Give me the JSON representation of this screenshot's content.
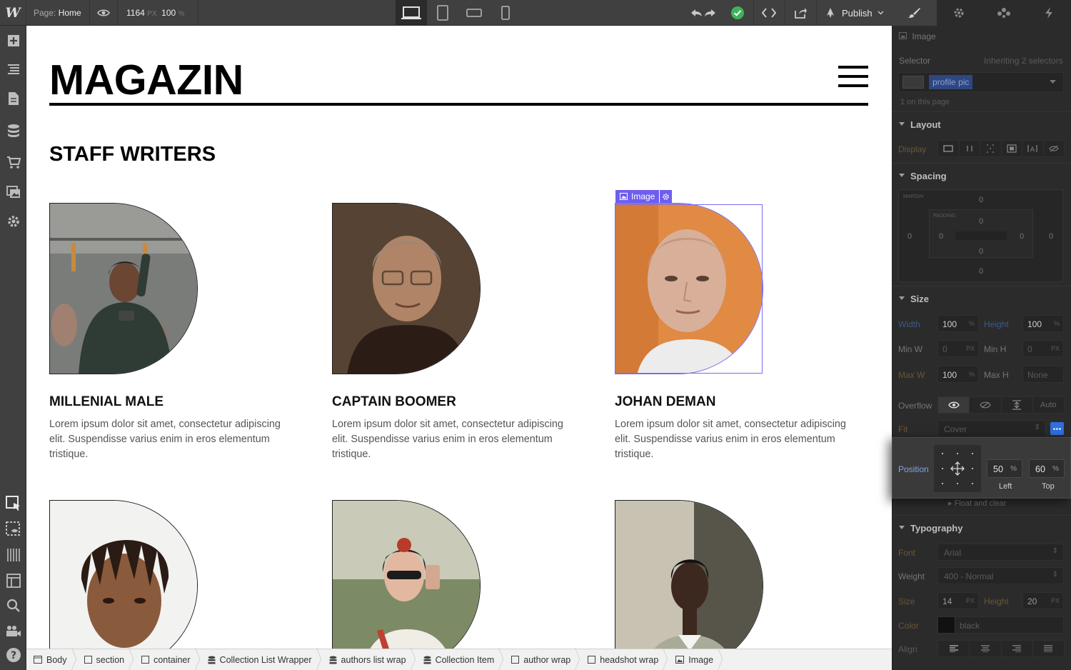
{
  "app": {
    "logo": "W",
    "page_label": "Page:",
    "page_name": "Home",
    "canvas_width": "1164",
    "canvas_width_unit": "PX",
    "zoom": "100",
    "zoom_unit": "%",
    "publish_label": "Publish"
  },
  "site": {
    "brand": "MAGAZIN",
    "section_title": "STAFF WRITERS",
    "selected_label": "Image",
    "writers": [
      {
        "name": "MILLENIAL MALE",
        "bio": "Lorem ipsum dolor sit amet, consectetur adipiscing elit. Suspendisse varius enim in eros elementum tristique."
      },
      {
        "name": "CAPTAIN BOOMER",
        "bio": "Lorem ipsum dolor sit amet, consectetur adipiscing elit. Suspendisse varius enim in eros elementum tristique."
      },
      {
        "name": "JOHAN DEMAN",
        "bio": "Lorem ipsum dolor sit amet, consectetur adipiscing elit. Suspendisse varius enim in eros elementum tristique."
      }
    ]
  },
  "breadcrumbs": [
    "Body",
    "section",
    "container",
    "Collection List Wrapper",
    "authors list wrap",
    "Collection Item",
    "author wrap",
    "headshot wrap",
    "Image"
  ],
  "panel": {
    "element_type": "Image",
    "selector_label": "Selector",
    "inheriting": "Inheriting 2 selectors",
    "class_name": "profile pic",
    "on_page": "1 on this page",
    "layout": "Layout",
    "display": "Display",
    "spacing": "Spacing",
    "margin": "MARGIN",
    "padding": "PADDING",
    "zero": "0",
    "size": "Size",
    "width_label": "Width",
    "width_val": "100",
    "height_label": "Height",
    "height_val": "100",
    "pct": "%",
    "px": "PX",
    "min_w_label": "Min W",
    "min_w_val": "0",
    "min_h_label": "Min H",
    "min_h_val": "0",
    "max_w_label": "Max W",
    "max_w_val": "100",
    "max_h_label": "Max H",
    "max_h_val": "None",
    "overflow_label": "Overflow",
    "overflow_auto": "Auto",
    "fit_label": "Fit",
    "fit_val": "Cover",
    "position_label": "Position",
    "pos_left_val": "50",
    "pos_top_val": "60",
    "left_cap": "Left",
    "top_cap": "Top",
    "float_clear": "Float and clear",
    "typography": "Typography",
    "font_label": "Font",
    "font_val": "Arial",
    "weight_label": "Weight",
    "weight_val": "400 - Normal",
    "size_label": "Size",
    "size_val": "14",
    "lh_label": "Height",
    "lh_val": "20",
    "color_label": "Color",
    "color_val": "black",
    "align_label": "Align"
  },
  "colors": {
    "selection": "#6e5ef0",
    "publish_check": "#3fb35a",
    "class_chip": "#3a5bb8"
  }
}
